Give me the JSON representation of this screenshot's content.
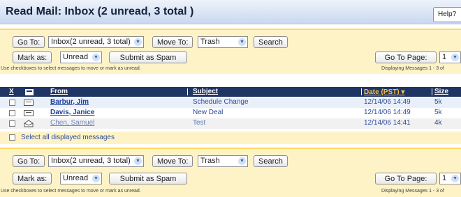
{
  "header": {
    "title": "Read Mail:  Inbox (2 unread, 3 total )",
    "help_label": "Help?"
  },
  "toolbar_top": {
    "goto_label": "Go To:",
    "folder_value": "Inbox(2 unread, 3 total)",
    "moveto_label": "Move To:",
    "move_target": "Trash",
    "search_label": "Search",
    "markas_label": "Mark as:",
    "mark_value": "Unread",
    "spam_label": "Submit as Spam",
    "gotopage_label": "Go To Page:",
    "page_value": "1",
    "hint": "Use checkboxes to select messages to move or mark as unread.",
    "displaying": "Displaying Messages 1 - 3 of"
  },
  "toolbar_bottom": {
    "goto_label": "Go To:",
    "folder_value": "Inbox(2 unread, 3 total)",
    "moveto_label": "Move To:",
    "move_target": "Trash",
    "search_label": "Search",
    "markas_label": "Mark as:",
    "mark_value": "Unread",
    "spam_label": "Submit as Spam",
    "gotopage_label": "Go To Page:",
    "page_value": "1",
    "hint": "Use checkboxes to select messages to move or mark as unread.",
    "displaying": "Displaying Messages 1 - 3 of"
  },
  "table": {
    "columns": {
      "check": "X",
      "from": "From",
      "subject": "Subject",
      "date": "Date (PST) ▾",
      "size": "Size"
    },
    "rows": [
      {
        "from": "Barbur, Jim",
        "subject": "Schedule Change",
        "date": "12/14/06 14:49",
        "size": "5k",
        "unread": true
      },
      {
        "from": "Davis, Janice",
        "subject": "New Deal",
        "date": "12/14/06 14:49",
        "size": "5k",
        "unread": true
      },
      {
        "from": "Chen, Samuel",
        "subject": "Test",
        "date": "12/14/06 14:41",
        "size": "4k",
        "unread": false
      }
    ],
    "select_all_label": "Select all displayed messages"
  },
  "colors": {
    "header_bg": "#c9d8ef",
    "toolbar_bg": "#fdf3c7",
    "table_header_bg": "#1f3564",
    "date_header": "#ffc23f",
    "link": "#1b3e9b"
  },
  "icons": {
    "envelope_closed": "envelope-closed-icon",
    "envelope_open": "envelope-open-icon",
    "inbox": "inbox-icon"
  }
}
